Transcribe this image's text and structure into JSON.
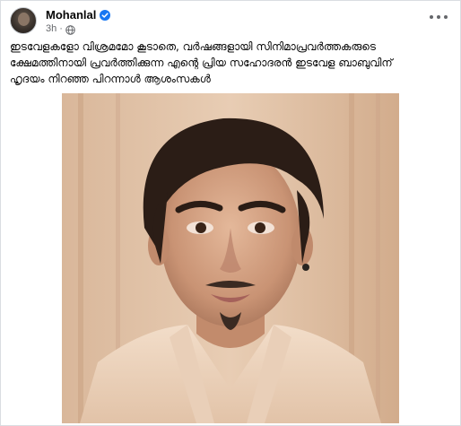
{
  "post": {
    "author": "Mohanlal",
    "timestamp": "3h",
    "separator": "·",
    "caption_lines": [
      "ഇടവേളകളോ വിശ്രമമോ കൂടാതെ, വർഷങ്ങളായി സിനിമാപ്രവർത്തകരുടെ",
      "ക്ഷേമത്തിനായി പ്രവർത്തിക്കുന്ന എന്റെ പ്രിയ സഹോദരൻ ഇടവേള ബാബുവിന്",
      "ഹൃദയം നിറഞ്ഞ പിറന്നാൾ ആശംസകൾ"
    ]
  },
  "icons": {
    "verified": "verified-badge-icon",
    "audience": "globe-icon",
    "more": "more-options-icon"
  },
  "colors": {
    "verified_blue": "#1877f2",
    "secondary_text": "#65676b"
  }
}
